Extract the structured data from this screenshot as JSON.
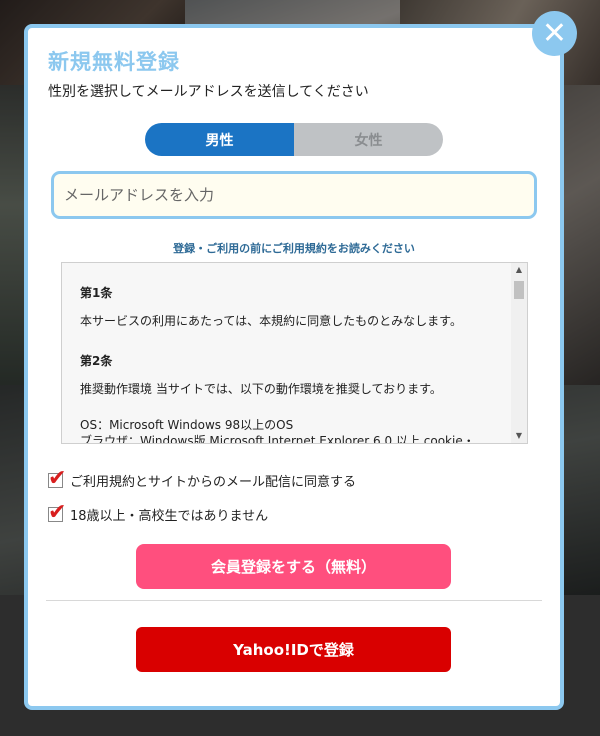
{
  "modal": {
    "title": "新規無料登録",
    "subtitle": "性別を選択してメールアドレスを送信してください",
    "close_icon": "close-icon",
    "accent_color": "#8cc8ef"
  },
  "gender": {
    "options": [
      "男性",
      "女性"
    ],
    "selected": "男性",
    "selected_color": "#1b74c4"
  },
  "email": {
    "placeholder": "メールアドレスを入力",
    "value": ""
  },
  "terms": {
    "heading": "登録・ご利用の前にご利用規約をお読みください",
    "articles": [
      {
        "title": "第1条",
        "lines": [
          "本サービスの利用にあたっては、本規約に同意したものとみなします。"
        ]
      },
      {
        "title": "第2条",
        "lines": [
          "推奨動作環境 当サイトでは、以下の動作環境を推奨しております。",
          "OS：Microsoft Windows 98以上のOS",
          "ブラウザ：Windows版 Microsoft Internet Explorer 6.0 以上 cookie・"
        ]
      }
    ]
  },
  "agreements": [
    {
      "label": "ご利用規約とサイトからのメール配信に同意する",
      "checked": true
    },
    {
      "label": "18歳以上・高校生ではありません",
      "checked": true
    }
  ],
  "buttons": {
    "register": "会員登録をする（無料）",
    "register_color": "#ff4f7e",
    "yahoo": "Yahoo!IDで登録",
    "yahoo_color": "#d90000"
  }
}
